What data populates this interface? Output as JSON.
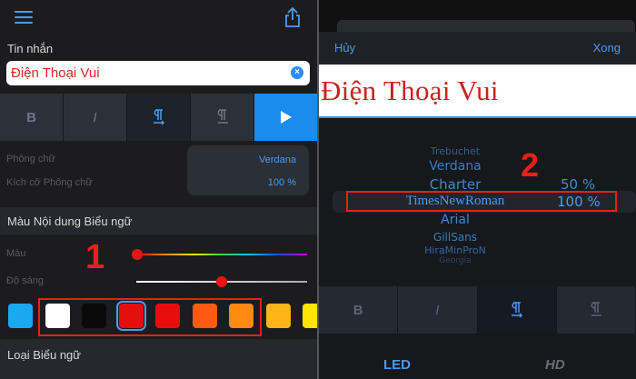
{
  "left": {
    "message_label": "Tin nhắn",
    "message_value": "Điện Thoại Vui",
    "font_label": "Phông chữ",
    "font_value": "Verdana",
    "font_size_label": "Kích cỡ Phông chữ",
    "font_size_value": "100 %",
    "banner_color_section": "Màu Nội dung Biểu ngữ",
    "color_label": "Màu",
    "brightness_label": "Độ sáng",
    "step_number": "1",
    "swatches": [
      "#1aa8ef",
      "#ffffff",
      "#0a0a0a",
      "#e60d0d",
      "#e80e0e",
      "#ff5a12",
      "#ff8a12",
      "#ffb417",
      "#ffe400"
    ],
    "selected_swatch": 3,
    "color_slider_value": 0.0,
    "brightness_slider_value": 0.5,
    "banner_type_section": "Loại Biểu ngữ"
  },
  "right": {
    "cancel": "Hủy",
    "done": "Xong",
    "preview_text": "Điện Thoại Vui",
    "step_number": "2",
    "fonts": [
      "Trebuchet",
      "Verdana",
      "Charter",
      "TimesNewRoman",
      "Arial",
      "GillSans",
      "HiraMinProN",
      "Georgia"
    ],
    "selected_font": "TimesNewRoman",
    "sizes": [
      "50 %",
      "100 %"
    ],
    "selected_size": "100 %",
    "tabs": [
      "LED",
      "HD"
    ]
  },
  "colors": {
    "accent": "#4a9bf0",
    "highlight_red": "#e8201a"
  }
}
